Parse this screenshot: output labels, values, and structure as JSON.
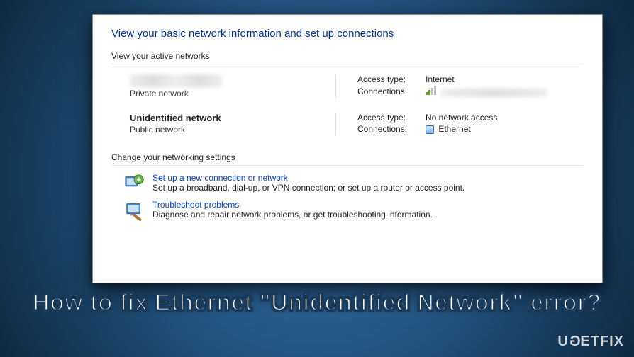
{
  "window": {
    "page_title": "View your basic network information and set up connections",
    "active_networks_label": "View your active networks",
    "networks": [
      {
        "name_hidden": true,
        "type": "Private network",
        "access_label": "Access type:",
        "access_value": "Internet",
        "connections_label": "Connections:",
        "connection_name_hidden": true,
        "connection_kind": "wifi"
      },
      {
        "name": "Unidentified network",
        "type": "Public network",
        "access_label": "Access type:",
        "access_value": "No network access",
        "connections_label": "Connections:",
        "connection_name": "Ethernet",
        "connection_kind": "ethernet"
      }
    ],
    "change_settings_label": "Change your networking settings",
    "settings": [
      {
        "icon": "setup-connection-icon",
        "title": "Set up a new connection or network",
        "desc": "Set up a broadband, dial-up, or VPN connection; or set up a router or access point."
      },
      {
        "icon": "troubleshoot-icon",
        "title": "Troubleshoot problems",
        "desc": "Diagnose and repair network problems, or get troubleshooting information."
      }
    ]
  },
  "caption": "How to fix Ethernet \"Unidentified Network\" error?",
  "watermark": "UGƎTFIX"
}
